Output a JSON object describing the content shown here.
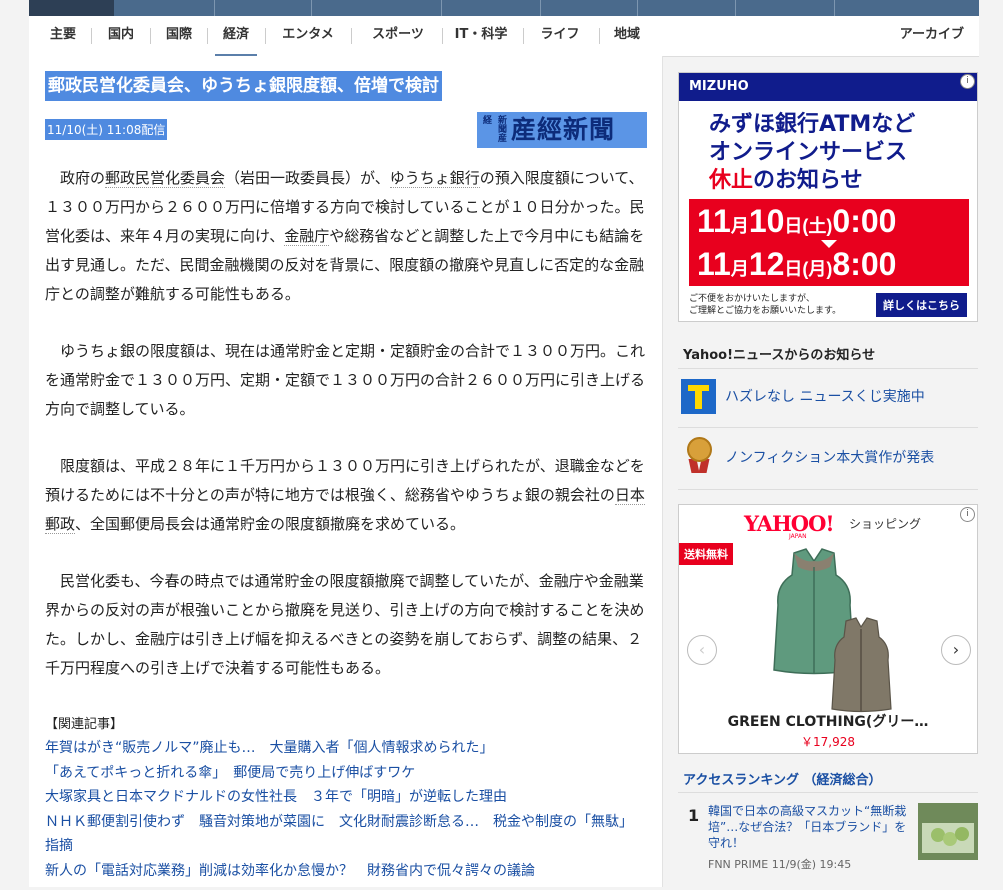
{
  "nav": {
    "items": [
      "主要",
      "国内",
      "国際",
      "経済",
      "エンタメ",
      "スポーツ",
      "IT・科学",
      "ライフ",
      "地域"
    ],
    "active": "経済",
    "archive": "アーカイブ"
  },
  "article": {
    "headline": "郵政民営化委員会、ゆうちょ銀限度額、倍増で検討",
    "date": "11/10(土) 11:08配信",
    "source_small": "新聞産経",
    "source_logo": "産經新聞",
    "paragraphs": [
      [
        "政府の",
        {
          "u": "郵政民営化委員会"
        },
        "（岩田一政委員長）が、",
        {
          "u": "ゆうちょ銀行"
        },
        "の預入限度額について、１３００万円から２６００万円に倍増する方向で検討していることが１０日分かった。民営化委は、来年４月の実現に向け、",
        {
          "u": "金融庁"
        },
        "や総務省などと調整した上で今月中にも結論を出す見通し。ただ、民間金融機関の反対を背景に、限度額の撤廃や見直しに否定的な金融庁との調整が難航する可能性もある。"
      ],
      [
        "ゆうちょ銀の限度額は、現在は通常貯金と定期・定額貯金の合計で１３００万円。これを通常貯金で１３００万円、定期・定額で１３００万円の合計２６００万円に引き上げる方向で調整している。"
      ],
      [
        "限度額は、平成２８年に１千万円から１３００万円に引き上げられたが、退職金などを預けるためには不十分との声が特に地方では根強く、総務省やゆうちょ銀の親会社の",
        {
          "u": "日本郵政"
        },
        "、全国郵便局長会は通常貯金の限度額撤廃を求めている。"
      ],
      [
        "民営化委も、今春の時点では通常貯金の限度額撤廃で調整していたが、金融庁や金融業界からの反対の声が根強いことから撤廃を見送り、引き上げの方向で検討することを決めた。しかし、金融庁は引き上げ幅を抑えるべきとの姿勢を崩しておらず、調整の結果、２千万円程度への引き上げで決着する可能性もある。"
      ]
    ],
    "related_title": "【関連記事】",
    "related": [
      "年賀はがき“販売ノルマ”廃止も…　大量購入者「個人情報求められた」",
      "「あえてポキっと折れる傘」　郵便局で売り上げ伸ばすワケ",
      "大塚家具と日本マクドナルドの女性社長　３年で「明暗」が逆転した理由",
      "ＮＨＫ郵便割引使わず　騒音対策地が菜園に　文化財耐震診断怠る…　税金や制度の「無駄」指摘",
      "新人の「電話対応業務」削減は効率化か怠慢か？　財務省内で侃々諤々の議論"
    ]
  },
  "ad_mizuho": {
    "brand": "MIZUHO",
    "line1": "みずほ銀行ATMなど",
    "line2": "オンラインサービス",
    "line3_a": "休止",
    "line3_b": "のお知らせ",
    "date1": {
      "m": "11",
      "mu": "月",
      "d": "10",
      "du": "日",
      "w": "(土)",
      "t": "0:00"
    },
    "date2": {
      "m": "11",
      "mu": "月",
      "d": "12",
      "du": "日",
      "w": "(月)",
      "t": "8:00"
    },
    "note1": "ご不便をおかけいたしますが、",
    "note2": "ご理解とご協力をお願いいたします。",
    "detail": "詳しくはこちら",
    "info": "i"
  },
  "notices": {
    "title": "Yahoo!ニュースからのお知らせ",
    "items": [
      "ハズレなし ニュースくじ実施中",
      "ノンフィクション本大賞作が発表"
    ]
  },
  "ad_yahoo": {
    "brand": "YAHOO!",
    "japan": "JAPAN",
    "shop": "ショッピング",
    "badge": "送料無料",
    "product": "GREEN CLOTHING(グリー…",
    "price": "￥17,928",
    "info": "i",
    "prev": "‹",
    "next": "›"
  },
  "ranking": {
    "title": "アクセスランキング （経済総合）",
    "items": [
      {
        "num": "1",
        "title": "韓国で日本の高級マスカット“無断栽培”…なぜ合法？「日本ブランド」を守れ！",
        "source": "FNN PRIME 11/9(金) 19:45"
      }
    ]
  }
}
